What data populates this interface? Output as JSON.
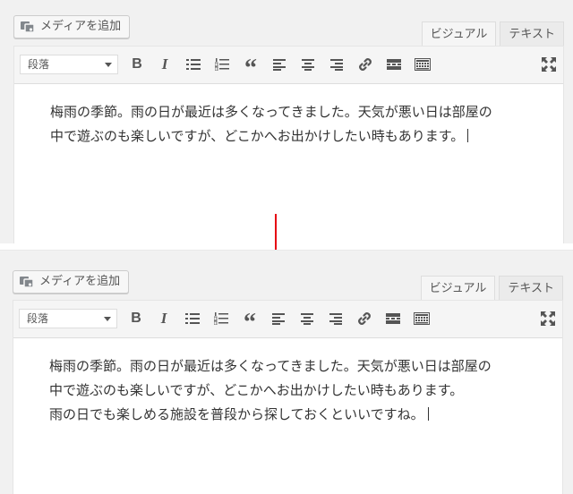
{
  "before": {
    "media_button_label": "メディアを追加",
    "tabs": [
      {
        "label": "ビジュアル",
        "active": true
      },
      {
        "label": "テキスト",
        "active": false
      }
    ],
    "format_select_value": "段落",
    "toolbar": {
      "bold": "B",
      "italic": "I",
      "blockquote": "“",
      "buttons": [
        "bold",
        "italic",
        "bulleted-list",
        "numbered-list",
        "blockquote",
        "align-left",
        "align-center",
        "align-right",
        "insert-link",
        "insert-more-tag",
        "toolbar-toggle",
        "fullscreen"
      ]
    },
    "lines": [
      "梅雨の季節。雨の日が最近は多くなってきました。天気が悪い日は部屋の",
      "中で遊ぶのも楽しいですが、どこかへお出かけしたい時もあります。"
    ]
  },
  "after": {
    "media_button_label": "メディアを追加",
    "tabs": [
      {
        "label": "ビジュアル",
        "active": true
      },
      {
        "label": "テキスト",
        "active": false
      }
    ],
    "format_select_value": "段落",
    "toolbar": {
      "bold": "B",
      "italic": "I",
      "blockquote": "“",
      "buttons": [
        "bold",
        "italic",
        "bulleted-list",
        "numbered-list",
        "blockquote",
        "align-left",
        "align-center",
        "align-right",
        "insert-link",
        "insert-more-tag",
        "toolbar-toggle",
        "fullscreen"
      ]
    },
    "lines": [
      "梅雨の季節。雨の日が最近は多くなってきました。天気が悪い日は部屋の",
      "中で遊ぶのも楽しいですが、どこかへお出かけしたい時もあります。",
      "雨の日でも楽しめる施設を普段から探しておくといいですね。"
    ]
  },
  "colors": {
    "arrow": "#e60012",
    "panel_background": "#f1f1f1",
    "toolbar_background": "#f5f5f5",
    "icon": "#555555"
  },
  "icons": {
    "media": "media-icon",
    "fullscreen": "fullscreen-icon"
  }
}
